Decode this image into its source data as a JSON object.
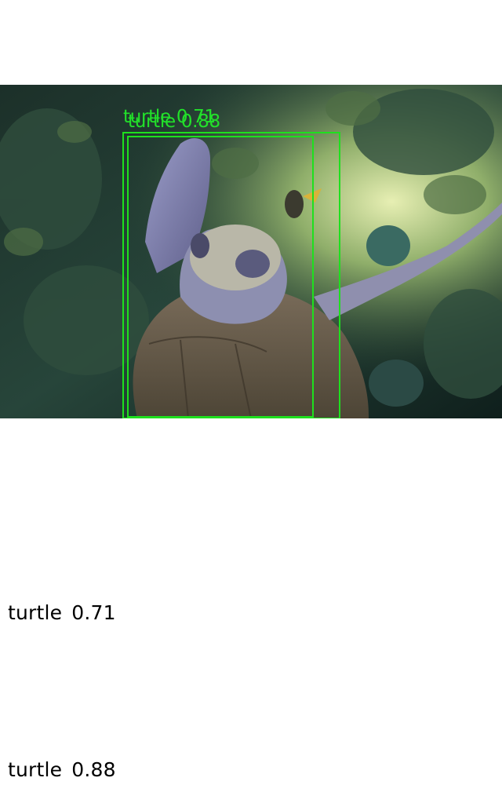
{
  "detections": [
    {
      "label": "turtle",
      "score": "0.71",
      "box_color": "#1ee01e"
    },
    {
      "label": "turtle",
      "score": "0.88",
      "box_color": "#1ee01e"
    }
  ],
  "captions": [
    {
      "label": "turtle",
      "score": "0.71"
    },
    {
      "label": "turtle",
      "score": "0.88"
    }
  ],
  "scene": {
    "description_icon": "underwater-turtle-photo"
  }
}
